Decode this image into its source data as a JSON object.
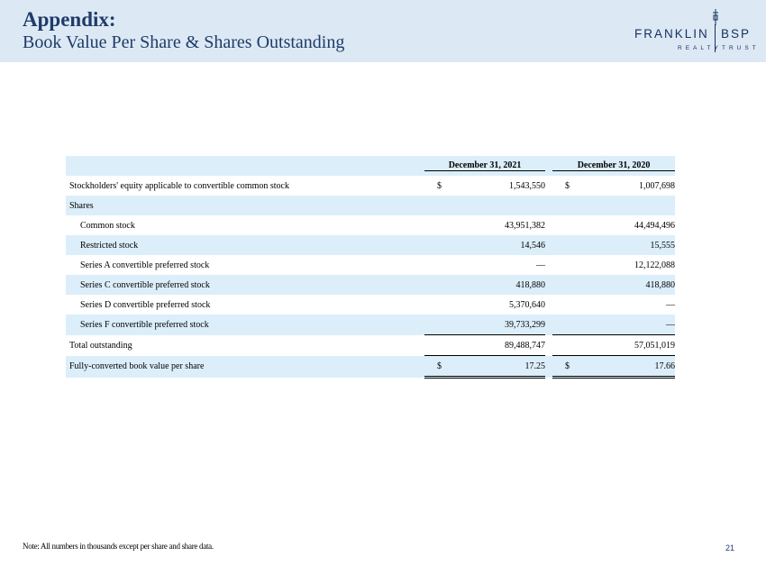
{
  "header": {
    "title": "Appendix:",
    "subtitle": "Book Value Per Share & Shares Outstanding",
    "logo_word_left": "FRANKLIN",
    "logo_word_right": "BSP",
    "logo_sub_left": "REALTY",
    "logo_sub_right": "TRUST"
  },
  "table": {
    "col1_header": "December 31, 2021",
    "col2_header": "December 31, 2020",
    "rows": [
      {
        "label": "Stockholders' equity applicable to convertible common stock",
        "cur1": "$",
        "v1": "1,543,550",
        "cur2": "$",
        "v2": "1,007,698"
      },
      {
        "label": "Shares",
        "cur1": "",
        "v1": "",
        "cur2": "",
        "v2": ""
      },
      {
        "label": "Common stock",
        "cur1": "",
        "v1": "43,951,382",
        "cur2": "",
        "v2": "44,494,496"
      },
      {
        "label": "Restricted stock",
        "cur1": "",
        "v1": "14,546",
        "cur2": "",
        "v2": "15,555"
      },
      {
        "label": "Series A convertible preferred stock",
        "cur1": "",
        "v1": "—",
        "cur2": "",
        "v2": "12,122,088"
      },
      {
        "label": "Series C convertible preferred stock",
        "cur1": "",
        "v1": "418,880",
        "cur2": "",
        "v2": "418,880"
      },
      {
        "label": "Series D convertible preferred stock",
        "cur1": "",
        "v1": "5,370,640",
        "cur2": "",
        "v2": "—"
      },
      {
        "label": "Series F convertible preferred stock",
        "cur1": "",
        "v1": "39,733,299",
        "cur2": "",
        "v2": "—"
      },
      {
        "label": "Total outstanding",
        "cur1": "",
        "v1": "89,488,747",
        "cur2": "",
        "v2": "57,051,019"
      },
      {
        "label": "Fully-converted book value per share",
        "cur1": "$",
        "v1": "17.25",
        "cur2": "$",
        "v2": "17.66"
      }
    ]
  },
  "footer": {
    "note": "Note: All numbers in thousands except per share and share data.",
    "page_number": "21"
  },
  "colors": {
    "header_bg": "#dce9f5",
    "title": "#1f3b68",
    "row_shade": "#dceefa"
  }
}
